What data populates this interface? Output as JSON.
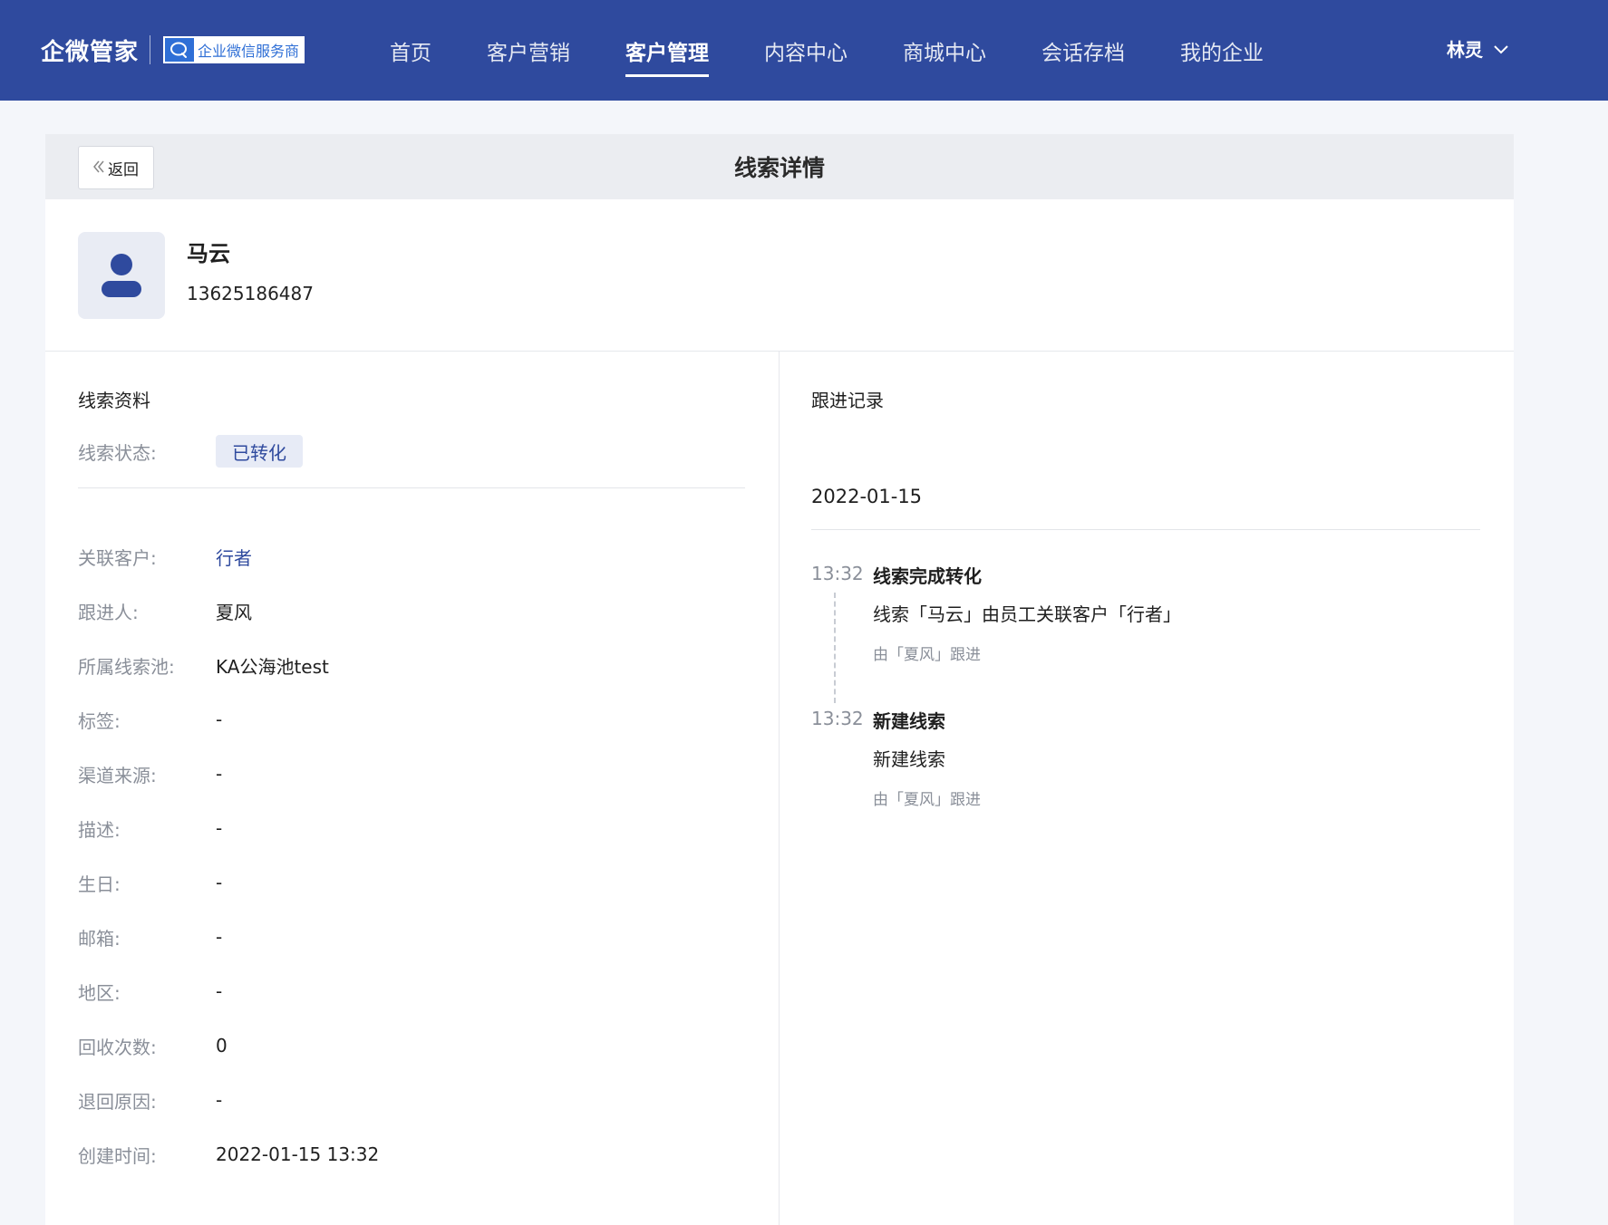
{
  "topbar": {
    "brand": "企微管家",
    "badge": "企业微信服务商",
    "nav": [
      "首页",
      "客户营销",
      "客户管理",
      "内容中心",
      "商城中心",
      "会话存档",
      "我的企业"
    ],
    "active_nav": "客户管理",
    "user": "林灵"
  },
  "header": {
    "back": "返回",
    "title": "线索详情"
  },
  "profile": {
    "name": "马云",
    "phone": "13625186487"
  },
  "lead_info": {
    "title": "线索资料",
    "status_label": "线索状态:",
    "status_value": "已转化",
    "fields": [
      {
        "label": "关联客户:",
        "value": "行者",
        "link": true
      },
      {
        "label": "跟进人:",
        "value": "夏风"
      },
      {
        "label": "所属线索池:",
        "value": "KA公海池test"
      },
      {
        "label": "标签:",
        "value": "-"
      },
      {
        "label": "渠道来源:",
        "value": "-"
      },
      {
        "label": "描述:",
        "value": "-"
      },
      {
        "label": "生日:",
        "value": "-"
      },
      {
        "label": "邮箱:",
        "value": "-"
      },
      {
        "label": "地区:",
        "value": "-"
      },
      {
        "label": "回收次数:",
        "value": "0"
      },
      {
        "label": "退回原因:",
        "value": "-"
      },
      {
        "label": "创建时间:",
        "value": "2022-01-15 13:32"
      }
    ]
  },
  "followup": {
    "title": "跟进记录",
    "date": "2022-01-15",
    "items": [
      {
        "time": "13:32",
        "title": "线索完成转化",
        "desc": "线索「马云」由员工关联客户「行者」",
        "by": "由「夏风」跟进"
      },
      {
        "time": "13:32",
        "title": "新建线索",
        "desc": "新建线索",
        "by": "由「夏风」跟进"
      }
    ]
  },
  "colors": {
    "primary": "#2f4a9e",
    "badge_blue": "#2f6fd6"
  },
  "icons": {
    "back": "double-chevron-left-icon",
    "user_menu": "chevron-down-icon",
    "avatar": "user-icon",
    "badge": "chat-bubble-icon"
  }
}
